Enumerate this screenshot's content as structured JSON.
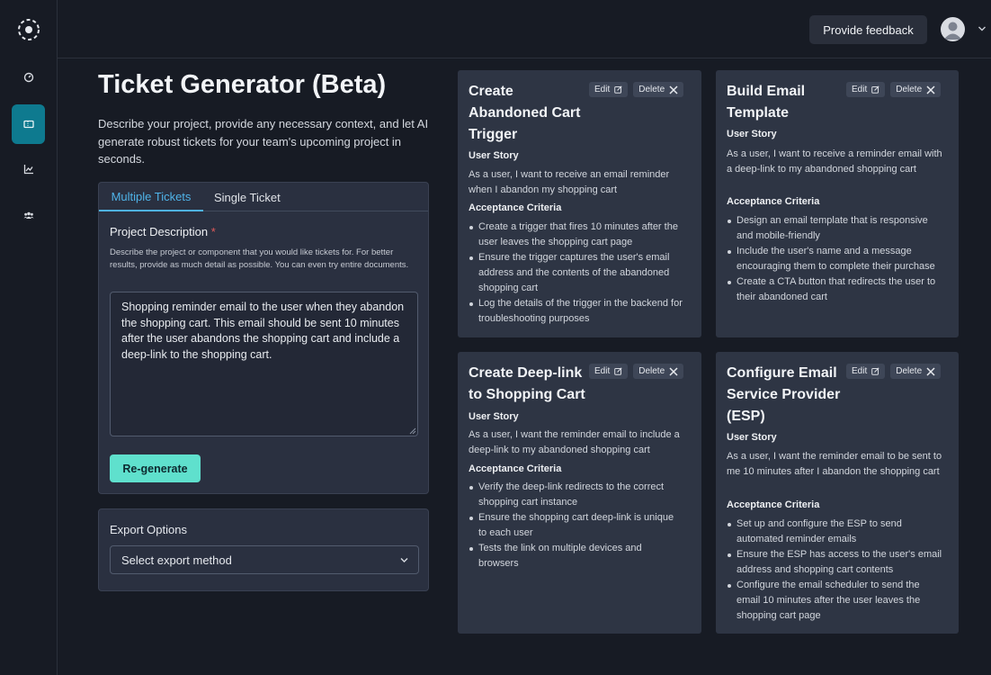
{
  "header": {
    "feedback_label": "Provide feedback"
  },
  "sidebar": {
    "items": [
      {
        "icon": "dashboard-icon"
      },
      {
        "icon": "ticket-icon",
        "active": true
      },
      {
        "icon": "chart-icon"
      },
      {
        "icon": "team-icon"
      }
    ]
  },
  "main": {
    "title": "Ticket Generator (Beta)",
    "description": "Describe your project, provide any necessary context, and let AI generate robust tickets for your team's upcoming project in seconds.",
    "tabs": [
      {
        "label": "Multiple Tickets",
        "active": true
      },
      {
        "label": "Single Ticket",
        "active": false
      }
    ],
    "project_label": "Project Description",
    "required_mark": "*",
    "project_help": "Describe the project or component that you would like tickets for. For better results, provide as much detail as possible. You can even try entire documents.",
    "project_value": "Shopping reminder email to the user when they abandon the shopping cart. This email should be sent 10 minutes after the user abandons the shopping cart and include a deep-link to the shopping cart.",
    "regenerate_label": "Re-generate",
    "export": {
      "title": "Export Options",
      "select_value": "Select export method"
    }
  },
  "tickets": [
    {
      "title": "Create Abandoned Cart Trigger",
      "edit_label": "Edit",
      "delete_label": "Delete",
      "story_heading": "User Story",
      "story": "As a user, I want to receive an email reminder when I abandon my shopping cart",
      "criteria_heading": "Acceptance Criteria",
      "criteria": [
        "Create a trigger that fires 10 minutes after the user leaves the shopping cart page",
        "Ensure the trigger captures the user's email address and the contents of the abandoned shopping cart",
        "Log the details of the trigger in the backend for troubleshooting purposes"
      ]
    },
    {
      "title": "Build Email Template",
      "edit_label": "Edit",
      "delete_label": "Delete",
      "story_heading": "User Story",
      "story": "As a user, I want to receive a reminder email with a deep-link to my abandoned shopping cart",
      "criteria_heading": "Acceptance Criteria",
      "criteria": [
        "Design an email template that is responsive and mobile-friendly",
        "Include the user's name and a message encouraging them to complete their purchase",
        "Create a CTA button that redirects the user to their abandoned cart"
      ]
    },
    {
      "title": "Create Deep-link to Shopping Cart",
      "edit_label": "Edit",
      "delete_label": "Delete",
      "story_heading": "User Story",
      "story": "As a user, I want the reminder email to include a deep-link to my abandoned shopping cart",
      "criteria_heading": "Acceptance Criteria",
      "criteria": [
        "Verify the deep-link redirects to the correct shopping cart instance",
        "Ensure the shopping cart deep-link is unique to each user",
        "Tests the link on multiple devices and browsers"
      ]
    },
    {
      "title": "Configure Email Service Provider (ESP)",
      "edit_label": "Edit",
      "delete_label": "Delete",
      "story_heading": "User Story",
      "story": "As a user, I want the reminder email to be sent to me 10 minutes after I abandon the shopping cart",
      "criteria_heading": "Acceptance Criteria",
      "criteria": [
        "Set up and configure the ESP to send automated reminder emails",
        "Ensure the ESP has access to the user's email address and shopping cart contents",
        "Configure the email scheduler to send the email 10 minutes after the user leaves the shopping cart page"
      ]
    }
  ],
  "colors": {
    "accent": "#4fb3e8",
    "active_nav": "#0e7a8f",
    "primary_button": "#5fe0cd",
    "required": "#e05a5a"
  }
}
